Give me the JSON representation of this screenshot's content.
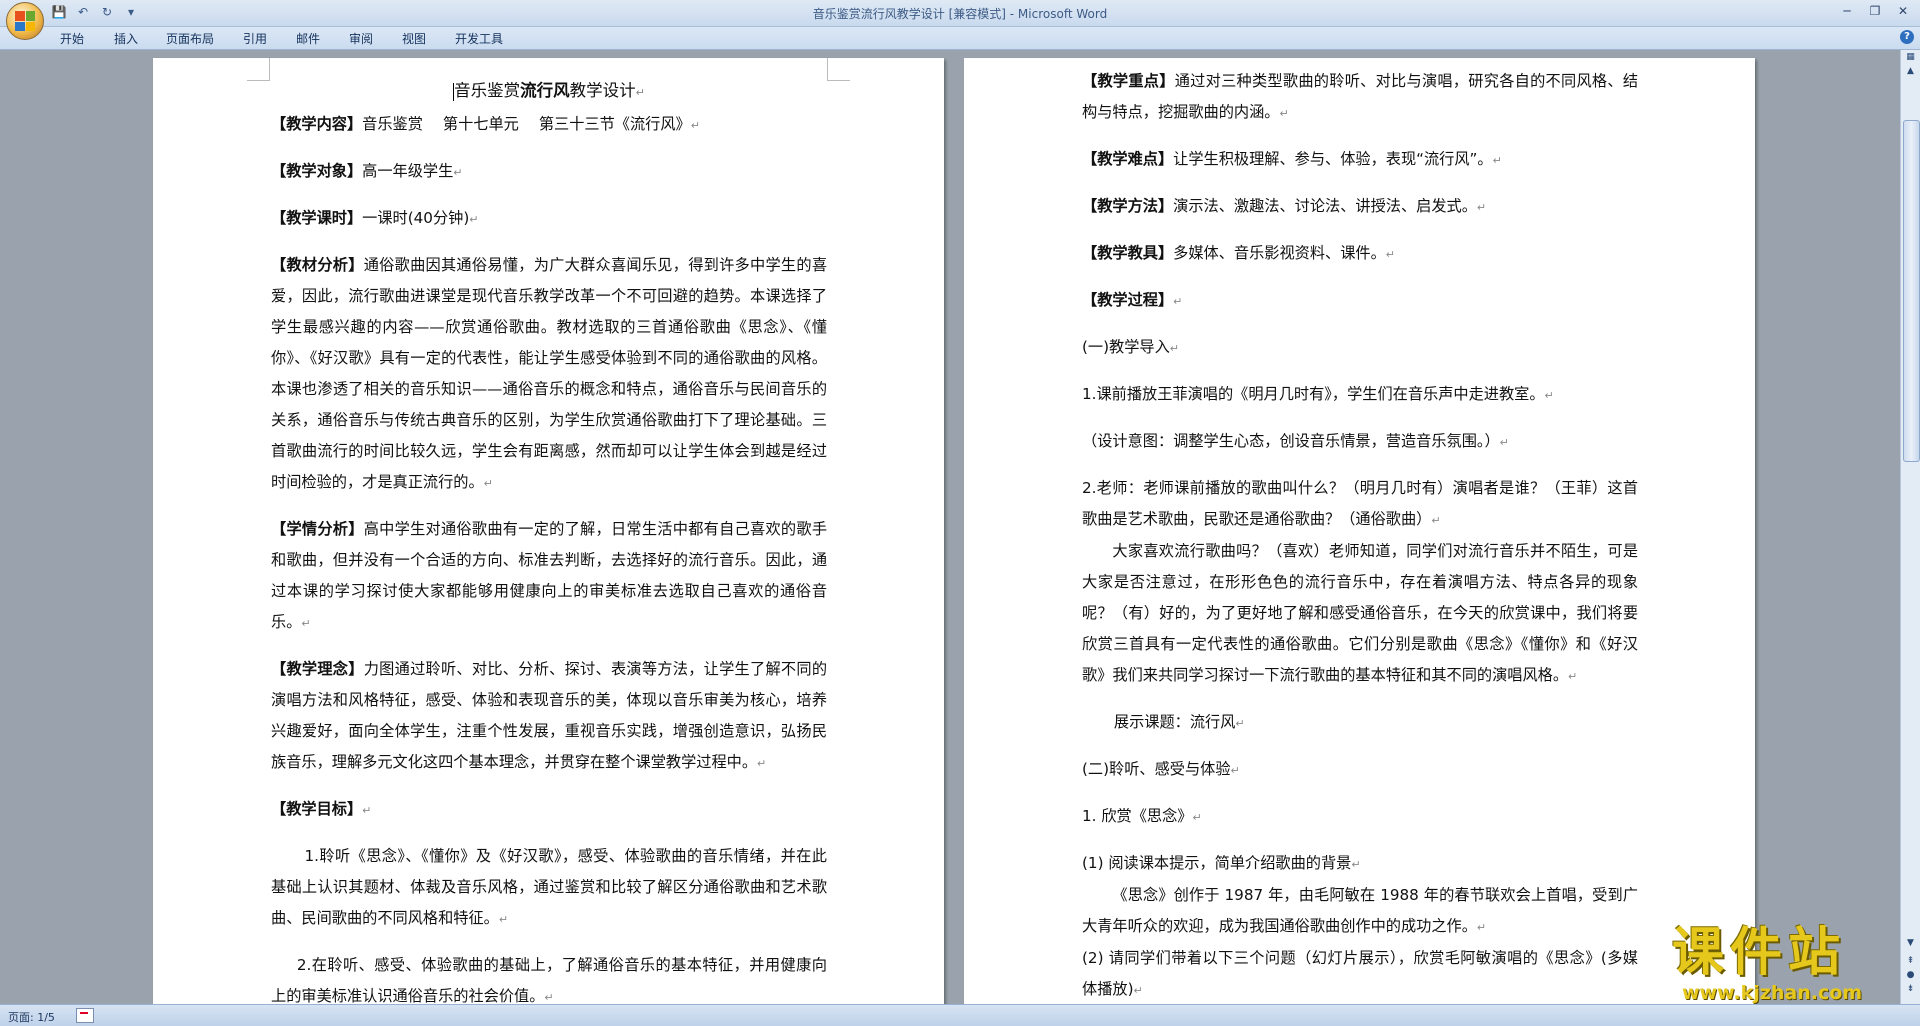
{
  "window": {
    "title": "音乐鉴赏流行风教学设计 [兼容模式] - Microsoft Word"
  },
  "ribbon_tabs": [
    "开始",
    "插入",
    "页面布局",
    "引用",
    "邮件",
    "审阅",
    "视图",
    "开发工具"
  ],
  "statusbar": {
    "page": "页面: 1/5"
  },
  "watermark": {
    "big": "课件站",
    "url": "www.kjzhan.com"
  },
  "page1": {
    "title_pre": "音乐鉴赏",
    "title_bold": "流行风",
    "title_post": "教学设计",
    "p1_label": "【教学内容】",
    "p1_text": "音乐鉴赏　 第十七单元　 第三十三节《流行风》",
    "p2_label": "【教学对象】",
    "p2_text": "高一年级学生",
    "p3_label": "【教学课时】",
    "p3_text": "一课时(40分钟)",
    "p4_label": "【教材分析】",
    "p4_text": "通俗歌曲因其通俗易懂，为广大群众喜闻乐见，得到许多中学生的喜爱，因此，流行歌曲进课堂是现代音乐教学改革一个不可回避的趋势。本课选择了学生最感兴趣的内容——欣赏通俗歌曲。教材选取的三首通俗歌曲《思念》、《懂你》、《好汉歌》具有一定的代表性，能让学生感受体验到不同的通俗歌曲的风格。本课也渗透了相关的音乐知识——通俗音乐的概念和特点，通俗音乐与民间音乐的关系，通俗音乐与传统古典音乐的区别，为学生欣赏通俗歌曲打下了理论基础。三首歌曲流行的时间比较久远，学生会有距离感，然而却可以让学生体会到越是经过时间检验的，才是真正流行的。",
    "p5_label": "【学情分析】",
    "p5_text": "高中学生对通俗歌曲有一定的了解，日常生活中都有自己喜欢的歌手和歌曲，但并没有一个合适的方向、标准去判断，去选择好的流行音乐。因此，通过本课的学习探讨使大家都能够用健康向上的审美标准去选取自己喜欢的通俗音乐。",
    "p6_label": "【教学理念】",
    "p6_text": "力图通过聆听、对比、分析、探讨、表演等方法，让学生了解不同的演唱方法和风格特征，感受、体验和表现音乐的美，体现以音乐审美为核心，培养兴趣爱好，面向全体学生，注重个性发展，重视音乐实践，增强创造意识，弘扬民族音乐，理解多元文化这四个基本理念，并贯穿在整个课堂教学过程中。",
    "p7_label": "【教学目标】",
    "p8_text": "1.聆听《思念》、《懂你》及《好汉歌》，感受、体验歌曲的音乐情绪，并在此基础上认识其题材、体裁及音乐风格，通过鉴赏和比较了解区分通俗歌曲和艺术歌曲、民间歌曲的不同风格和特征。",
    "p9_text": "2.在聆听、感受、体验歌曲的基础上，了解通俗音乐的基本特征，并用健康向上的审美标准认识通俗音乐的社会价值。"
  },
  "page2": {
    "q1_label": "【教学重点】",
    "q1_text": "通过对三种类型歌曲的聆听、对比与演唱，研究各自的不同风格、结构与特点，挖掘歌曲的内涵。",
    "q2_label": "【教学难点】",
    "q2_text": "让学生积极理解、参与、体验，表现“流行风”。",
    "q3_label": "【教学方法】",
    "q3_text": "演示法、激趣法、讨论法、讲授法、启发式。",
    "q4_label": "【教学教具】",
    "q4_text": "多媒体、音乐影视资料、课件。",
    "q5_label": "【教学过程】",
    "q6_text": "(一)教学导入",
    "q7_text": "1.课前播放王菲演唱的《明月几时有》，学生们在音乐声中走进教室。",
    "q8_text": "（设计意图：调整学生心态，创设音乐情景，营造音乐氛围。）",
    "q9_text": "2.老师：老师课前播放的歌曲叫什么？（明月几时有）演唱者是谁？（王菲）这首歌曲是艺术歌曲，民歌还是通俗歌曲？（通俗歌曲）",
    "q10_text": "大家喜欢流行歌曲吗？（喜欢）老师知道，同学们对流行音乐并不陌生，可是大家是否注意过，在形形色色的流行音乐中，存在着演唱方法、特点各异的现象呢？（有）好的，为了更好地了解和感受通俗音乐，在今天的欣赏课中，我们将要欣赏三首具有一定代表性的通俗歌曲。它们分别是歌曲《思念》《懂你》和《好汉歌》我们来共同学习探讨一下流行歌曲的基本特征和其不同的演唱风格。",
    "q11_text": "展示课题：流行风",
    "q12_text": "(二)聆听、感受与体验",
    "q13_text": "1. 欣赏《思念》",
    "q14_text": "(1) 阅读课本提示，简单介绍歌曲的背景",
    "q15_text": "《思念》创作于 1987 年，由毛阿敏在 1988 年的春节联欢会上首唱，受到广大青年听众的欢迎，成为我国通俗歌曲创作中的成功之作。",
    "q16_text": "(2) 请同学们带着以下三个问题（幻灯片展示），欣赏毛阿敏演唱的《思念》(多媒体播放)"
  }
}
